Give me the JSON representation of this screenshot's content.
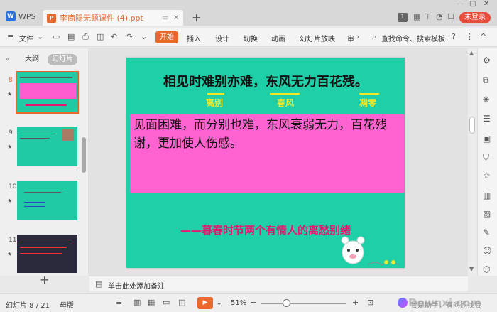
{
  "titlebar": {
    "app_name": "WPS",
    "doc_title": "李商隐无题课件 (4).ppt",
    "page_badge": "1",
    "login_label": "未登录"
  },
  "menubar": {
    "file_label": "文件",
    "start_label": "开始",
    "items": [
      "插入",
      "设计",
      "切换",
      "动画",
      "幻灯片放映",
      "审"
    ],
    "search_label": "查找命令、搜索模板"
  },
  "left_panel": {
    "tabs": [
      "大纲",
      "幻灯片"
    ],
    "thumbnails": [
      {
        "number": "8"
      },
      {
        "number": "9"
      },
      {
        "number": "10"
      },
      {
        "number": "11"
      }
    ]
  },
  "slide": {
    "title": "相见时难别亦难，东风无力百花残。",
    "keywords": [
      "离别",
      "春风",
      "凋零"
    ],
    "body": "见面困难，而分别也难，东风衰弱无力，百花残谢，更加使人伤感。",
    "subtitle": "——暮春时节两个有情人的离愁别绪"
  },
  "notes": {
    "placeholder": "单击此处添加备注"
  },
  "statusbar": {
    "slide_info": "幻灯片 8 / 21",
    "template": "母版",
    "zoom": "51%",
    "watermark": "Downxi.com",
    "helper_text": "我是助手，有问题找我"
  },
  "colors": {
    "accent": "#e8692e",
    "slide_bg": "#1fcfa8",
    "pink_box": "#ff63d1",
    "keyword": "#f0e82c",
    "subtitle": "#e8156e"
  }
}
